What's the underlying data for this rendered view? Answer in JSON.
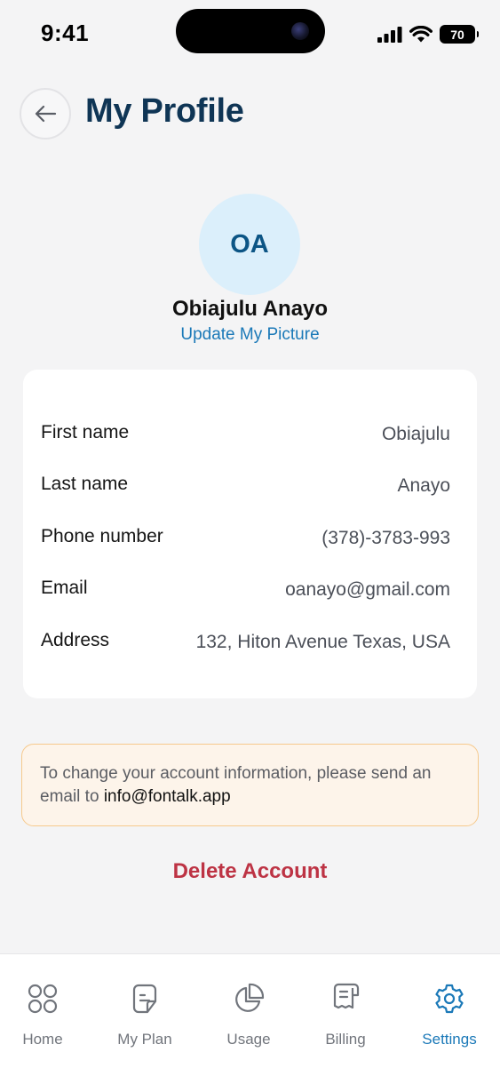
{
  "status_bar": {
    "time": "9:41",
    "battery": "70"
  },
  "header": {
    "title": "My Profile"
  },
  "profile": {
    "initials": "OA",
    "name": "Obiajulu Anayo",
    "update_picture": "Update My Picture"
  },
  "fields": {
    "first_name": {
      "label": "First name",
      "value": "Obiajulu"
    },
    "last_name": {
      "label": "Last name",
      "value": "Anayo"
    },
    "phone": {
      "label": "Phone number",
      "value": "(378)-3783-993"
    },
    "email": {
      "label": "Email",
      "value": "oanayo@gmail.com"
    },
    "address": {
      "label": "Address",
      "value": "132, Hiton Avenue Texas, USA"
    }
  },
  "notice": {
    "text": "To change your account information, please send an email to ",
    "email": "info@fontalk.app"
  },
  "delete_label": "Delete Account",
  "tabs": {
    "home": {
      "label": "Home",
      "icon": "grid-icon"
    },
    "plan": {
      "label": "My Plan",
      "icon": "document-icon"
    },
    "usage": {
      "label": "Usage",
      "icon": "pie-chart-icon"
    },
    "billing": {
      "label": "Billing",
      "icon": "receipt-icon"
    },
    "settings": {
      "label": "Settings",
      "icon": "gear-icon",
      "active": true
    }
  },
  "colors": {
    "title": "#0f3555",
    "accent": "#1b79b8",
    "danger": "#bd3344",
    "notice_bg": "#fdf4ea",
    "notice_border": "#f6c98c",
    "avatar_bg": "#dbeffb"
  }
}
